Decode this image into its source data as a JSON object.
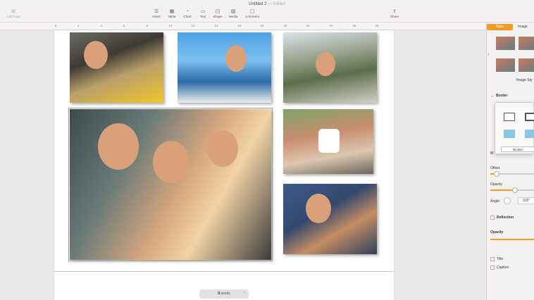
{
  "window": {
    "title": "Untitled 2",
    "separator": "—",
    "status": "Edited"
  },
  "toolbar": {
    "add_page": "Add Page",
    "items": [
      {
        "label": "Insert",
        "icon": "insert-icon"
      },
      {
        "label": "Table",
        "icon": "table-icon"
      },
      {
        "label": "Chart",
        "icon": "chart-icon"
      },
      {
        "label": "Text",
        "icon": "text-icon"
      },
      {
        "label": "Shape",
        "icon": "shape-icon"
      },
      {
        "label": "Media",
        "icon": "media-icon"
      },
      {
        "label": "Comment",
        "icon": "comment-icon"
      },
      {
        "label": "Share",
        "icon": "share-icon"
      }
    ]
  },
  "ruler": {
    "ticks": [
      "0",
      "2",
      "4",
      "6",
      "8",
      "10",
      "12",
      "14",
      "16",
      "18",
      "20",
      "22",
      "24",
      "26",
      "28"
    ]
  },
  "status_bar": {
    "word_count": "0",
    "word_label": "words"
  },
  "inspector": {
    "tabs": {
      "style": "Style",
      "image": "Image"
    },
    "image_styles_label": "Image Sty",
    "border_label": "Border",
    "no_border": "No Bor",
    "offset_label": "Offset",
    "opacity_label": "Opacity",
    "angle_label": "Angle:",
    "angle_value": "315°",
    "reflection_label": "Reflection",
    "opacity2_label": "Opacity",
    "title_label": "Title",
    "caption_label": "Caption",
    "blur_label": "Bl",
    "offset_level": 0.15,
    "opacity_level": 0.55,
    "accent_color": "#f29b22"
  }
}
